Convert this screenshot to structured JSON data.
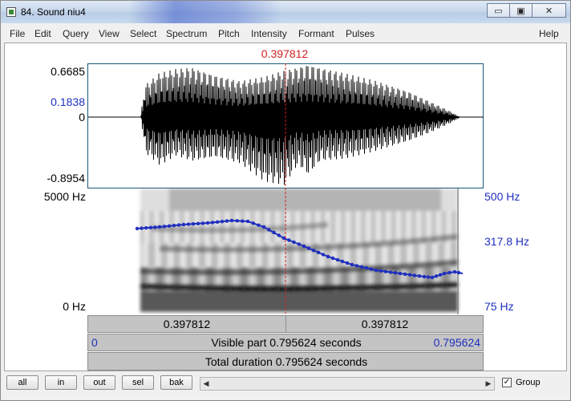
{
  "window": {
    "title": "84. Sound niu4",
    "minimize_glyph": "▭",
    "maximize_glyph": "▣",
    "close_glyph": "✕"
  },
  "menu": [
    "File",
    "Edit",
    "Query",
    "View",
    "Select",
    "Spectrum",
    "Pitch",
    "Intensity",
    "Formant",
    "Pulses",
    "Help"
  ],
  "cursor_time": "0.397812",
  "waveform": {
    "max_label": "0.6685",
    "cursor_value_label": "0.1838",
    "zero_label": "0",
    "min_label": "-0.8954"
  },
  "spectrogram": {
    "top_freq_label": "5000 Hz",
    "bottom_freq_label": "0 Hz",
    "pitch_top_label": "500 Hz",
    "pitch_cursor_label": "317.8 Hz",
    "pitch_bottom_label": "75 Hz"
  },
  "time_bar": {
    "left_label": "0.397812",
    "right_label": "0.397812"
  },
  "visible_bar": {
    "start": "0",
    "text": "Visible part 0.795624 seconds",
    "end": "0.795624"
  },
  "total_bar": {
    "text": "Total duration 0.795624 seconds"
  },
  "buttons": [
    "all",
    "in",
    "out",
    "sel",
    "bak"
  ],
  "scroll": {
    "left_arrow": "◀",
    "right_arrow": "▶"
  },
  "group": {
    "label": "Group",
    "checked_glyph": "✓"
  },
  "colors": {
    "cursor": "#d42020",
    "pitch": "#1f2fbf",
    "waveform": "#000000"
  },
  "icons": {
    "app": "praat-sound-icon"
  }
}
